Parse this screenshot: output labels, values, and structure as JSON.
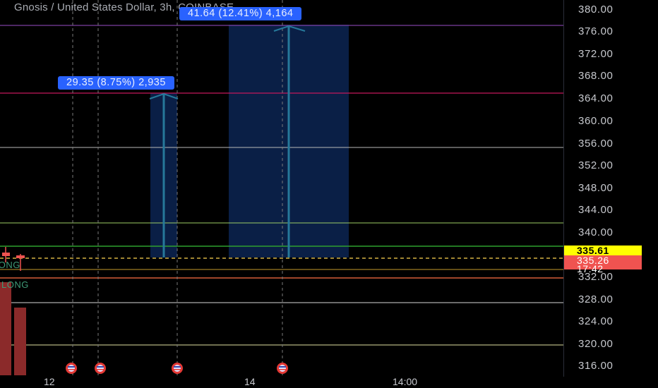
{
  "header": {
    "title": "Gnosis / United States Dollar, 3h, COINBASE"
  },
  "measurements": [
    {
      "label": "41.64 (12.41%) 4,164"
    },
    {
      "label": "29.35 (8.75%) 2,935"
    }
  ],
  "price_axis": {
    "ticks": [
      "380.00",
      "376.00",
      "372.00",
      "368.00",
      "364.00",
      "360.00",
      "356.00",
      "352.00",
      "348.00",
      "344.00",
      "340.00",
      "336.00",
      "332.00",
      "328.00",
      "324.00",
      "320.00",
      "316.00"
    ],
    "last_price_tag": {
      "price": "335.61",
      "bg": "#ffff00",
      "fg": "#000000"
    },
    "current_price_tag": {
      "price": "335.26",
      "countdown": "17:42",
      "bg": "#f05350",
      "fg": "#ffffff"
    }
  },
  "time_axis": {
    "labels": [
      "12",
      "14",
      "14:00"
    ]
  },
  "strategy_labels": [
    "LONG",
    "LONG"
  ],
  "colors": {
    "background": "#000000",
    "accent": "#2962ff",
    "bear_volume": "#8b2a2a",
    "green_line": "#2e8b2e",
    "event_marker": "#e53935"
  },
  "event_icons": [
    "us-flag-icon",
    "us-flag-icon",
    "us-flag-icon",
    "us-flag-icon"
  ]
}
